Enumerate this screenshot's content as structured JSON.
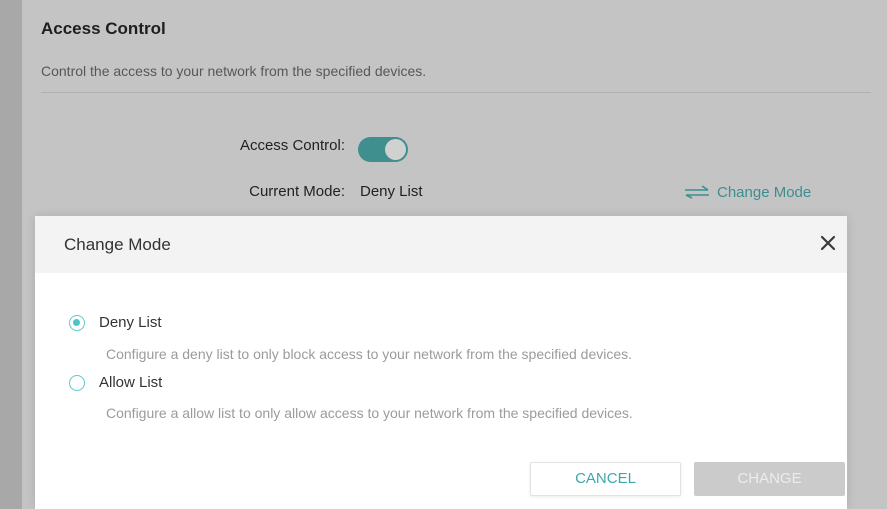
{
  "page": {
    "title": "Access Control",
    "description": "Control the access to your network from the specified devices.",
    "access_control_label": "Access Control:",
    "access_control_enabled": true,
    "current_mode_label": "Current Mode:",
    "current_mode_value": "Deny List",
    "change_mode_link": "Change Mode"
  },
  "dialog": {
    "title": "Change Mode",
    "options": [
      {
        "label": "Deny List",
        "description": "Configure a deny list to only block access to your network from the specified devices.",
        "selected": true
      },
      {
        "label": "Allow List",
        "description": "Configure a allow list to only allow access to your network from the specified devices.",
        "selected": false
      }
    ],
    "cancel_label": "CANCEL",
    "change_label": "CHANGE"
  },
  "colors": {
    "accent": "#4fc3c4",
    "toggle_on": "#3e8f8e",
    "button_disabled": "#cbcbcb"
  },
  "icons": {
    "close": "close-icon",
    "change_mode": "swap-arrows-icon"
  }
}
